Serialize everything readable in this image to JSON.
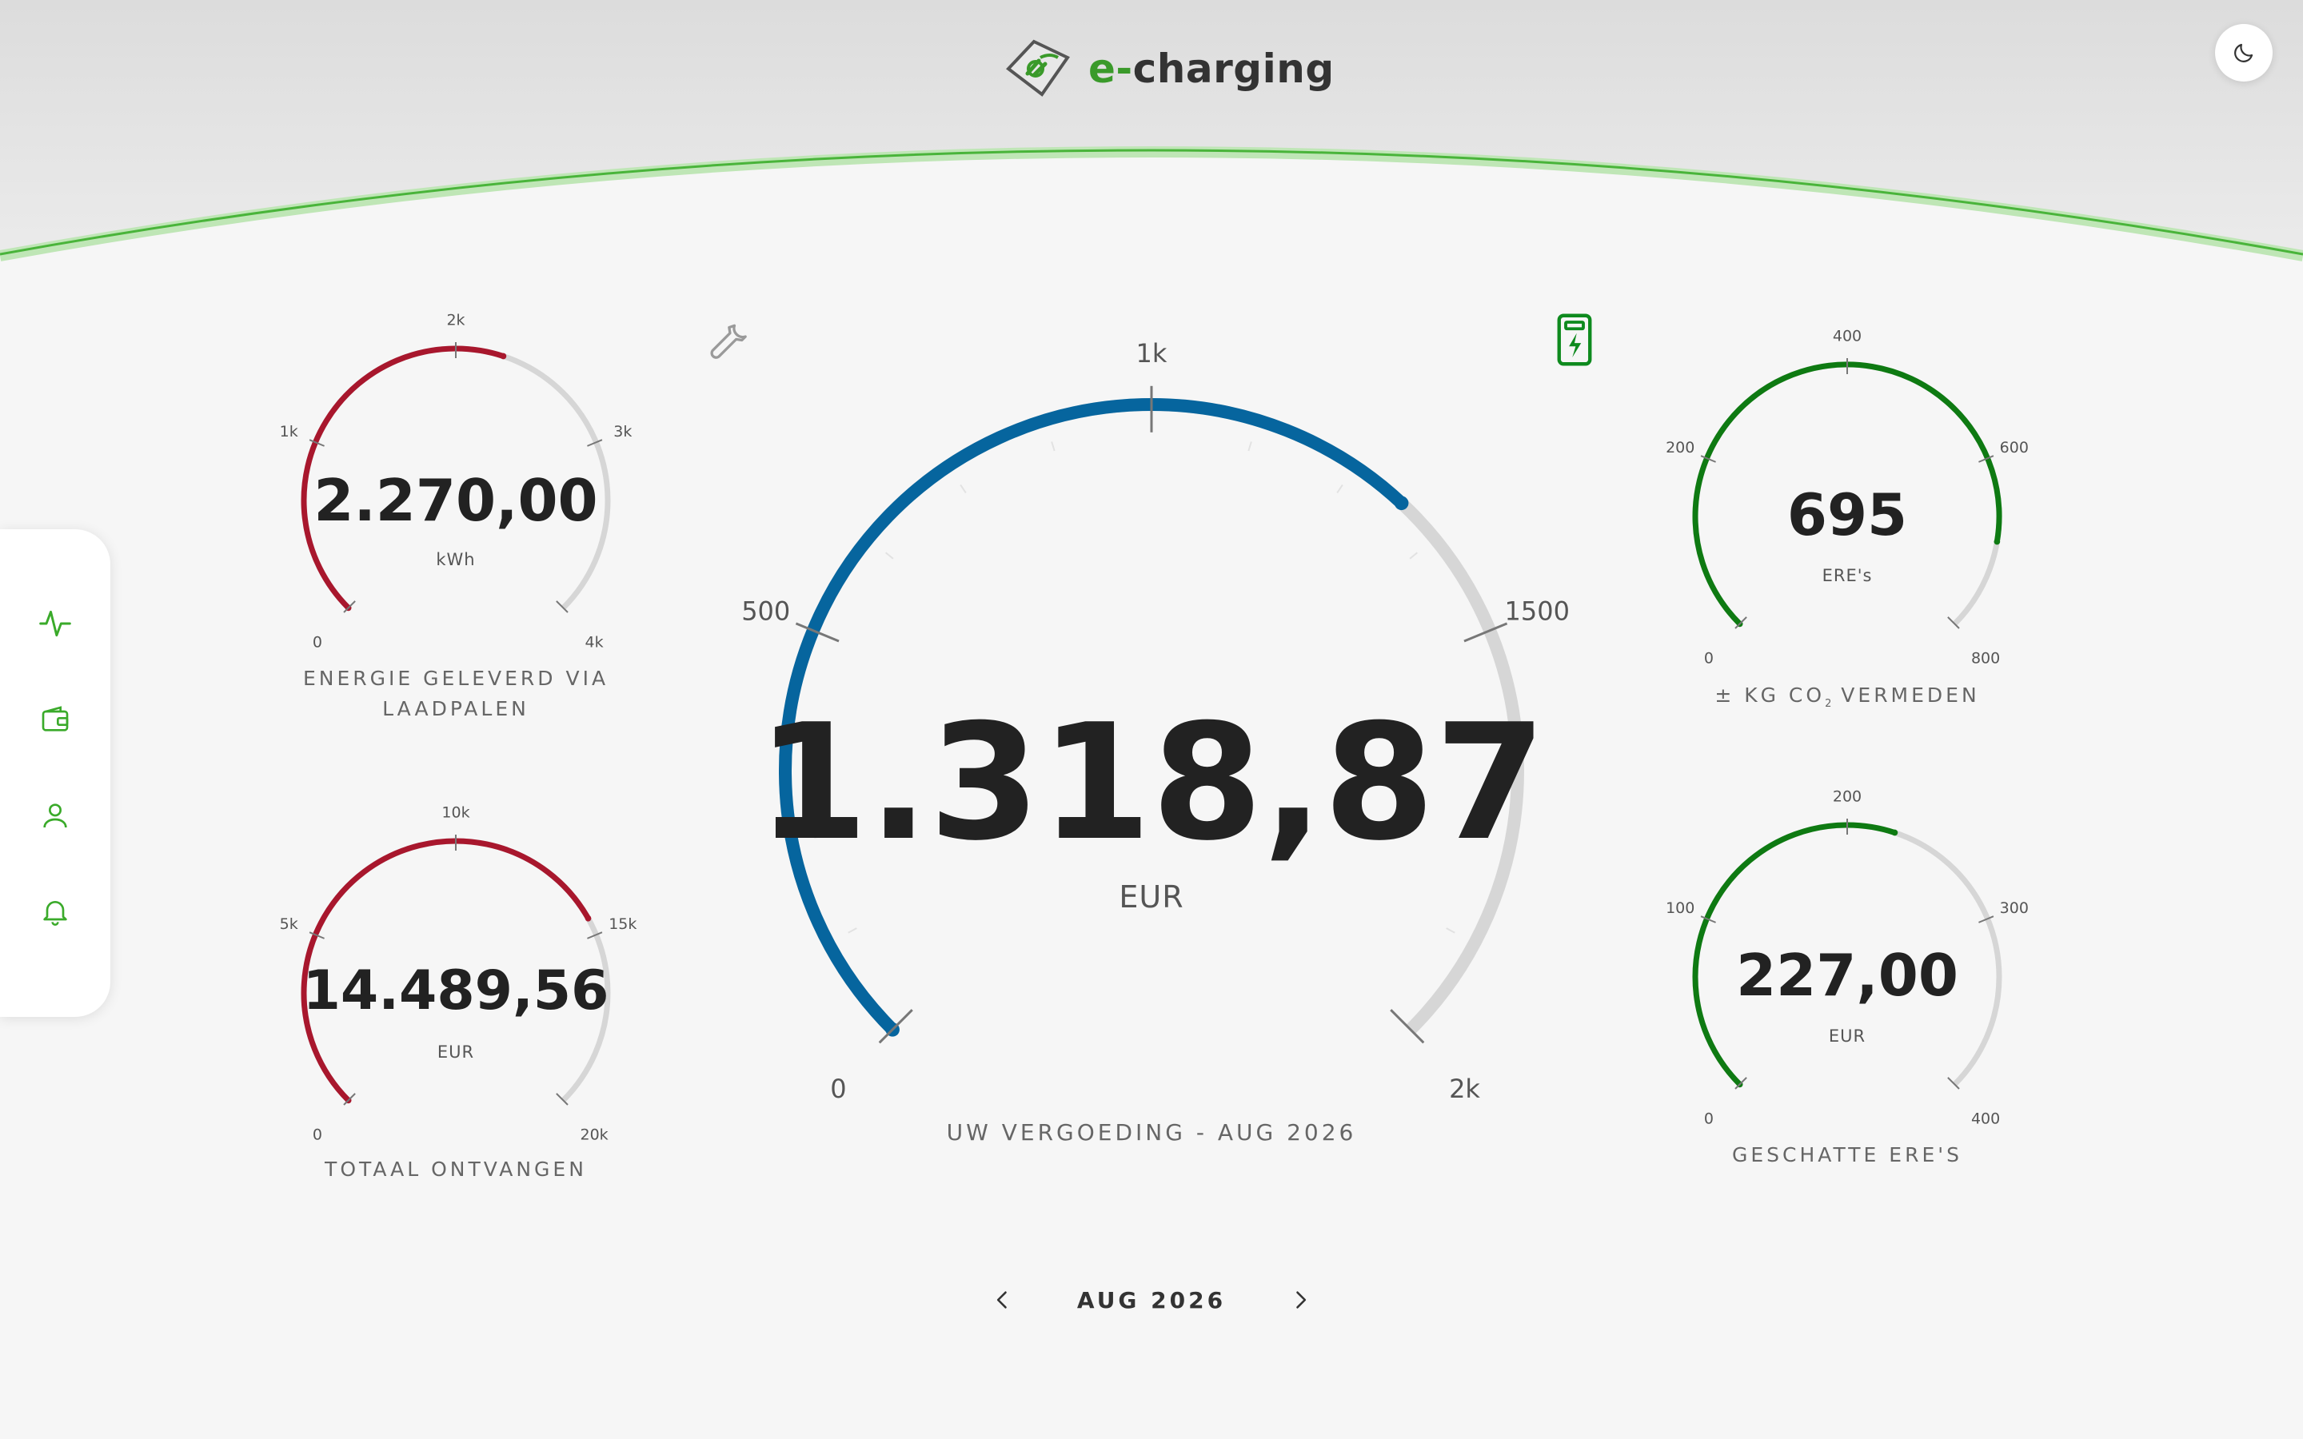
{
  "header": {
    "brand_prefix": "e-",
    "brand_name": "charging",
    "accent_color": "#3a9a2a"
  },
  "sidebar": {
    "items": [
      {
        "icon": "activity-icon"
      },
      {
        "icon": "wallet-icon"
      },
      {
        "icon": "user-icon"
      },
      {
        "icon": "bell-icon"
      }
    ]
  },
  "gauges": {
    "energy": {
      "value": "2.270,00",
      "unit": "kWh",
      "caption": "ENERGIE GELEVERD VIA LAADPALEN",
      "ticks": [
        "0",
        "1k",
        "2k",
        "3k",
        "4k"
      ],
      "max": 4000,
      "amount": 2270,
      "color": "#a8172d"
    },
    "received": {
      "value": "14.489,56",
      "unit": "EUR",
      "caption": "TOTAAL ONTVANGEN",
      "ticks": [
        "0",
        "5k",
        "10k",
        "15k",
        "20k"
      ],
      "max": 20000,
      "amount": 14489.56,
      "color": "#a8172d"
    },
    "main": {
      "value": "1.318,87",
      "unit": "EUR",
      "caption": "UW VERGOEDING - AUG 2026",
      "ticks": [
        "0",
        "500",
        "1k",
        "1500",
        "2k"
      ],
      "max": 2000,
      "amount": 1318.87,
      "color": "#06659e"
    },
    "co2": {
      "value": "695",
      "unit": "ERE's",
      "caption_pre": "± KG CO",
      "caption_sub": "2",
      "caption_post": " VERMEDEN",
      "ticks": [
        "0",
        "200",
        "400",
        "600",
        "800"
      ],
      "max": 800,
      "amount": 695,
      "color": "#0e7a12"
    },
    "estimated": {
      "value": "227,00",
      "unit": "EUR",
      "caption": "GESCHATTE ERE'S",
      "ticks": [
        "0",
        "100",
        "200",
        "300",
        "400"
      ],
      "max": 400,
      "amount": 227,
      "color": "#0e7a12"
    }
  },
  "nav": {
    "month": "AUG 2026"
  }
}
